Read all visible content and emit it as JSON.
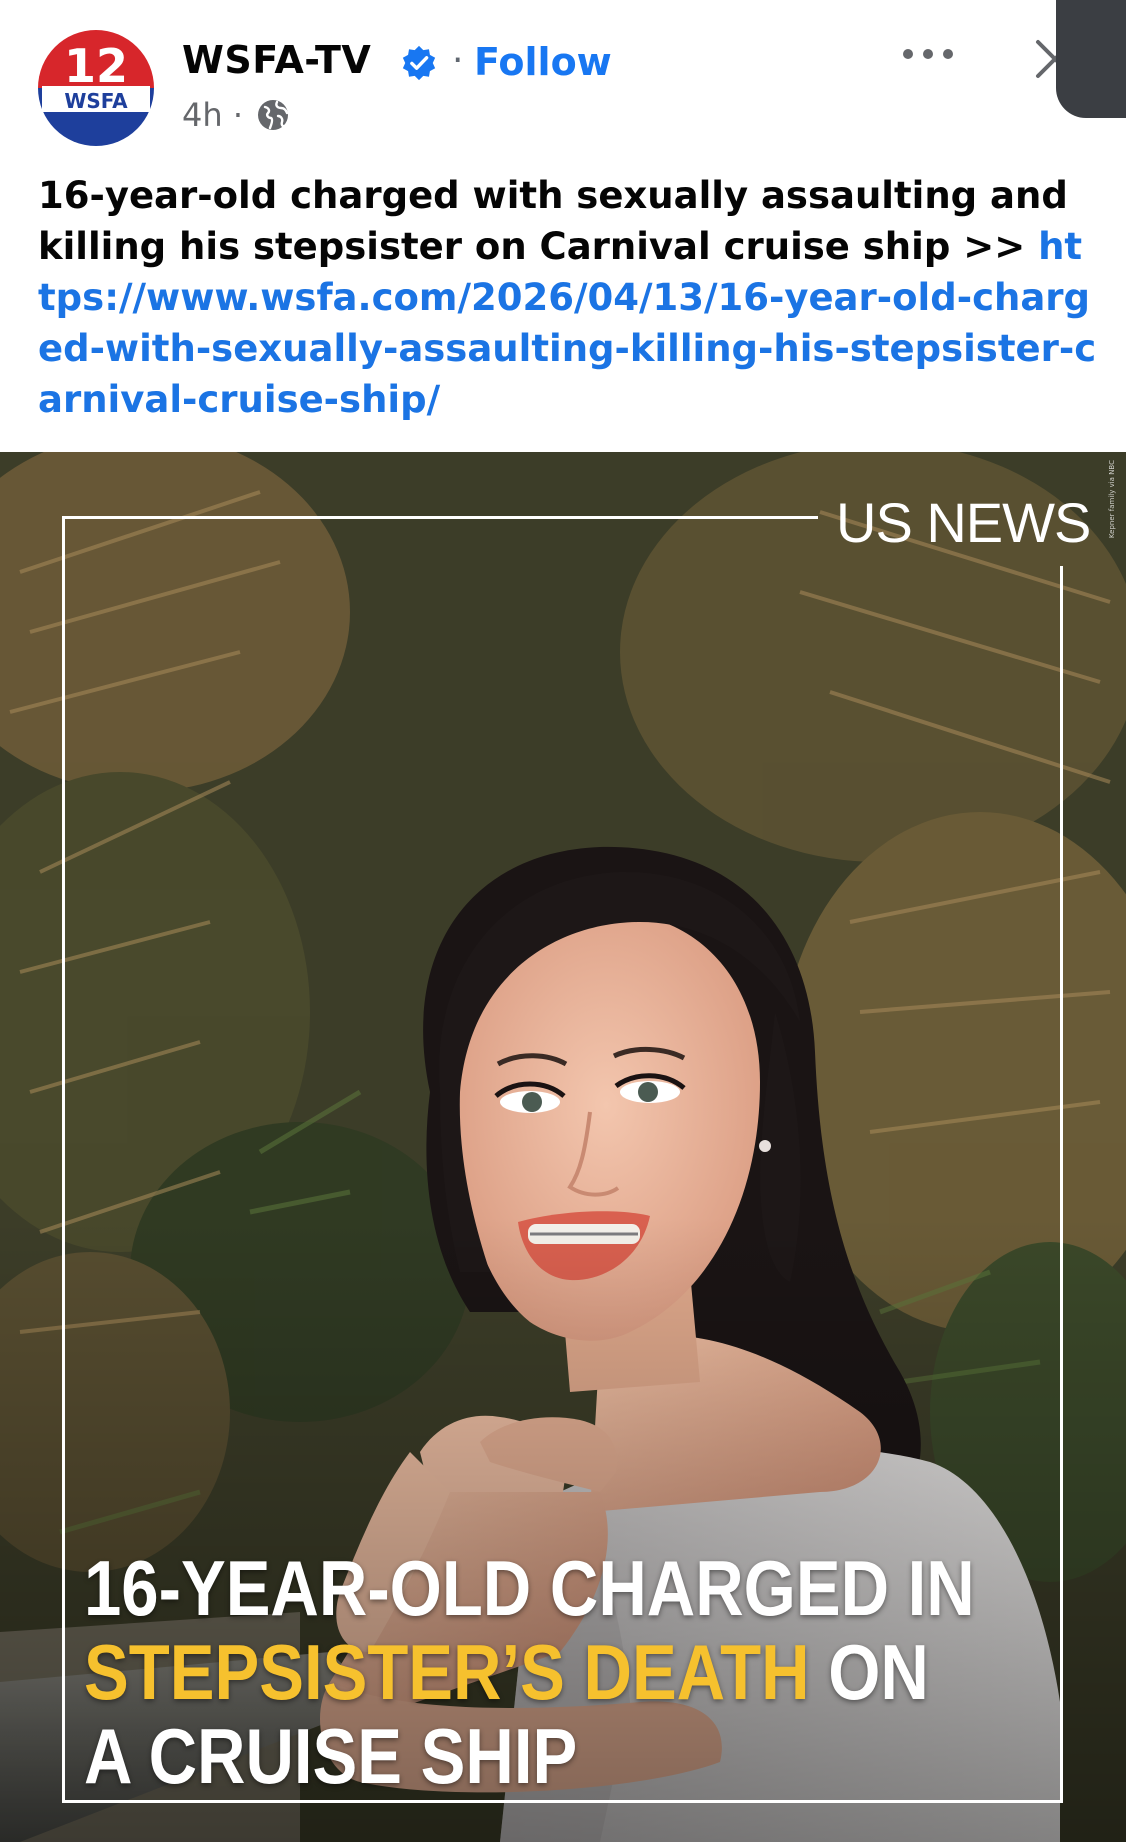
{
  "post": {
    "page_name": "WSFA-TV",
    "separator": "·",
    "follow_label": "Follow",
    "time": "4h ·",
    "avatar": {
      "number": "12",
      "call_sign": "WSFA"
    },
    "icons": {
      "verified": "verified-badge-icon",
      "audience": "globe-icon",
      "more": "more-options-icon",
      "close": "close-icon"
    },
    "caption": {
      "text": "16-year-old charged with sexually assaulting and killing his stepsister on Carnival cruise ship  >> ",
      "link": "https://www.wsfa.com/2026/04/13/16-year-old-charged-with-sexually-assaulting-killing-his-stepsister-carnival-cruise-ship/"
    }
  },
  "image": {
    "section_label": "US NEWS",
    "credit": "Kepner family via NBC",
    "headline_line1": "16-YEAR-OLD CHARGED IN",
    "headline_highlight": "STEPSISTER’S DEATH",
    "headline_line2_rest": " ON",
    "headline_line3": "A CRUISE SHIP"
  },
  "colors": {
    "link_blue": "#1b74e4",
    "follow_blue": "#1877f2",
    "verified_blue": "#1877f2",
    "highlight_yellow": "#f6c12e",
    "brand_red": "#d7262b",
    "brand_blue": "#1e3f9c"
  }
}
